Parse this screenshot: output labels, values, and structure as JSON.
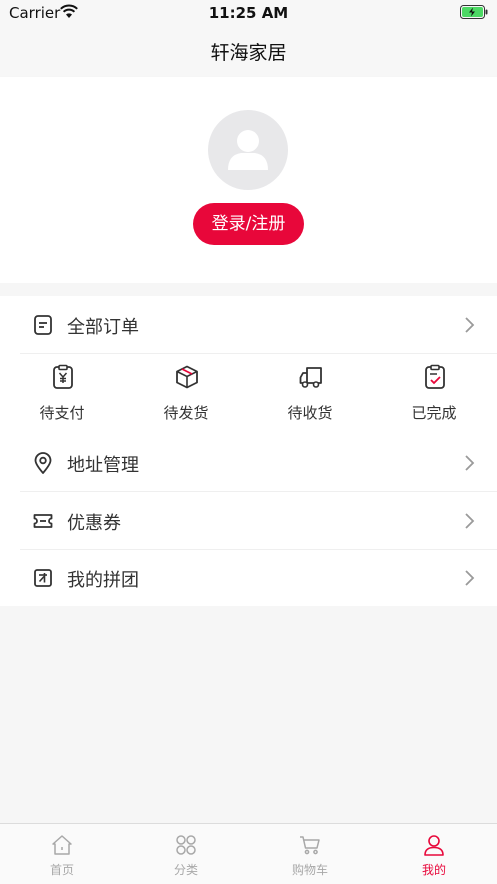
{
  "status_bar": {
    "carrier": "Carrier",
    "time": "11:25 AM"
  },
  "nav": {
    "title": "轩海家居"
  },
  "profile": {
    "login_label": "登录/注册"
  },
  "menu": {
    "all_orders": "全部订单",
    "order_status": [
      {
        "label": "待支付",
        "icon": "pending-payment-icon"
      },
      {
        "label": "待发货",
        "icon": "package-box-icon"
      },
      {
        "label": "待收货",
        "icon": "delivery-truck-icon"
      },
      {
        "label": "已完成",
        "icon": "completed-clipboard-icon"
      }
    ],
    "address": "地址管理",
    "coupons": "优惠券",
    "group_buy": "我的拼团"
  },
  "tabbar": {
    "items": [
      {
        "label": "首页",
        "icon": "home-icon"
      },
      {
        "label": "分类",
        "icon": "category-grid-icon"
      },
      {
        "label": "购物车",
        "icon": "cart-icon"
      },
      {
        "label": "我的",
        "icon": "user-icon"
      }
    ],
    "active_index": 3
  },
  "colors": {
    "accent": "#e8073a",
    "background": "#f6f6f6",
    "text": "#333333"
  }
}
